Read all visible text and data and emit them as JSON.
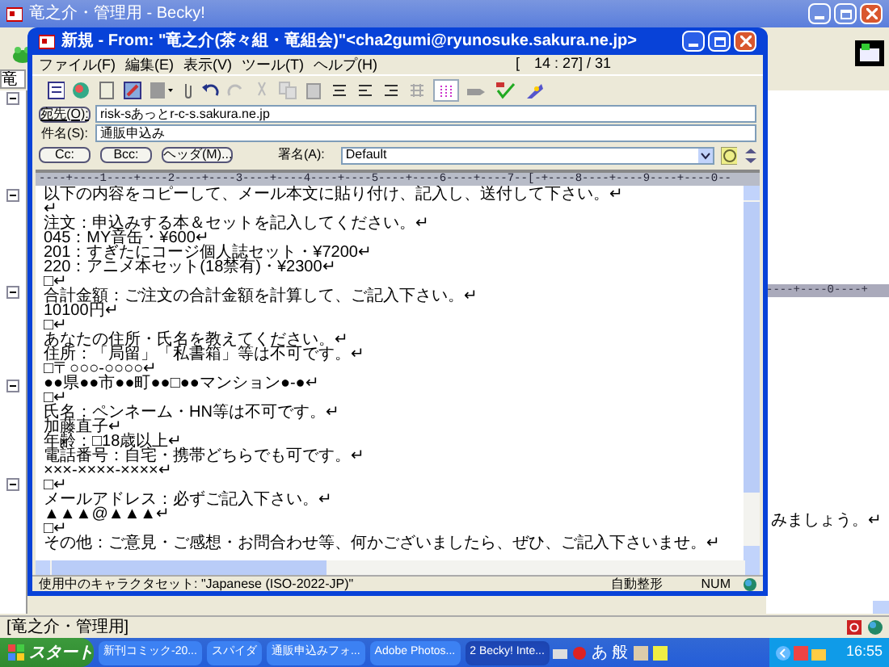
{
  "main_window": {
    "title": "竜之介・管理用 - Becky!",
    "folder_tab": "竜",
    "preview_line": "みましょう。↵",
    "preview_ruler": "----+----0----+",
    "status": "[竜之介・管理用]"
  },
  "compose": {
    "title": "新規 - From: \"竜之介(茶々組・竜組会)\"<cha2gumi@ryunosuke.sakura.ne.jp>",
    "menu": [
      "ファイル(F)",
      "編集(E)",
      "表示(V)",
      "ツール(T)",
      "ヘルプ(H)"
    ],
    "cursor_position": "[　14 : 27] / 31",
    "to_label": "宛先(O):",
    "to": "risk-sあっとr-c-s.sakura.ne.jp",
    "subject_label": "件名(S):",
    "subject": "通販申込み",
    "buttons": [
      "Cc:",
      "Bcc:",
      "ヘッダ(M)..."
    ],
    "signature_label": "署名(A):",
    "signature": "Default",
    "ruler": "----+----1----+----2----+----3----+----4----+----5----+----6----+----7--[-+----8----+----9----+----0--",
    "body": [
      "以下の内容をコピーして、メール本文に貼り付け、記入し、送付して下さい。↵",
      "↵",
      "注文：申込みする本＆セットを記入してください。↵",
      "045：MY音缶・¥600↵",
      "201：すぎたにコージ個人誌セット・¥7200↵",
      "220：アニメ本セット(18禁有)・¥2300↵",
      "□↵",
      "合計金額：ご注文の合計金額を計算して、ご記入下さい。↵",
      "10100円↵",
      "□↵",
      "あなたの住所・氏名を教えてください。↵",
      "住所：「局留」「私書箱」等は不可です。↵",
      "□〒○○○-○○○○↵",
      "●●県●●市●●町●●□●●マンション●-●↵",
      "□↵",
      "氏名：ペンネーム・HN等は不可です。↵",
      "加藤直子↵",
      "年齢：□18歳以上↵",
      "電話番号：自宅・携帯どちらでも可です。↵",
      "×××-××××-××××↵",
      "□↵",
      "メールアドレス：必ずご記入下さい。↵",
      "▲▲▲@▲▲▲↵",
      "□↵",
      "その他：ご意見・ご感想・お問合わせ等、何かございましたら、ぜひ、ご記入下さいませ。↵"
    ],
    "status": {
      "charset": "使用中のキャラクタセット: \"Japanese (ISO-2022-JP)\"",
      "mode": "自動整形",
      "num": "NUM"
    }
  },
  "taskbar": {
    "start": "スタート",
    "tasks": [
      {
        "label": "新刊コミック-20...",
        "selected": false
      },
      {
        "label": "スパイダ",
        "selected": false
      },
      {
        "label": "通販申込みフォ...",
        "selected": false
      },
      {
        "label": "Adobe Photos...",
        "selected": false
      },
      {
        "label": "2 Becky! Inte...",
        "selected": true
      }
    ],
    "ime": "あ 般",
    "clock": "16:55"
  }
}
